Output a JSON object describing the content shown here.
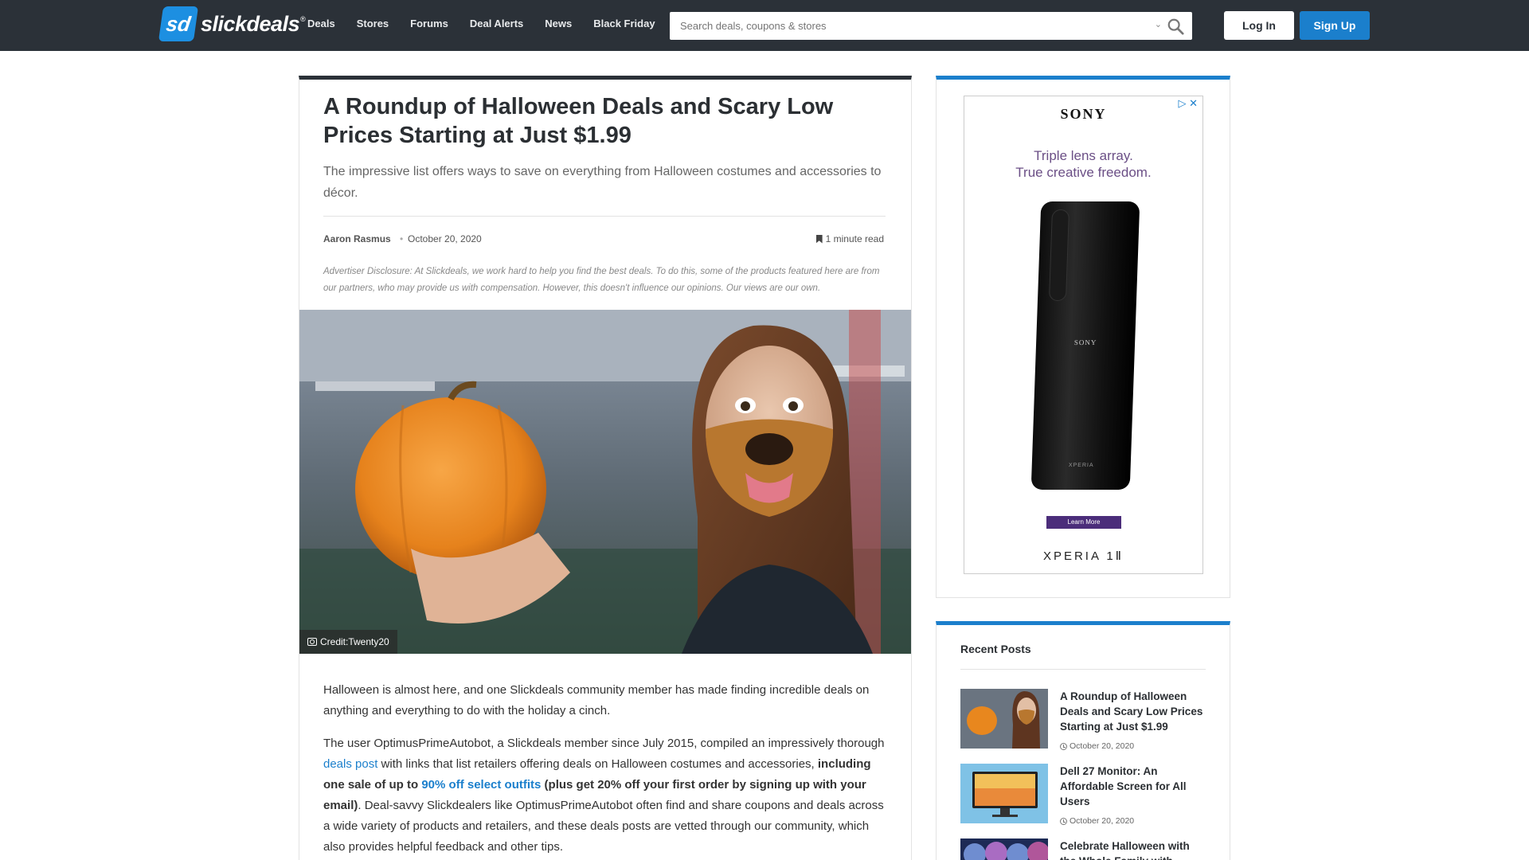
{
  "header": {
    "logo_text": "slickdeals",
    "logo_mark": "sd",
    "logo_reg": "®",
    "nav": [
      "Deals",
      "Stores",
      "Forums",
      "Deal Alerts",
      "News",
      "Black Friday"
    ],
    "search_placeholder": "Search deals, coupons & stores",
    "login_label": "Log In",
    "signup_label": "Sign Up",
    "icons": {
      "search": "search-icon",
      "dropdown": "chevron-down-icon"
    }
  },
  "article": {
    "title": "A Roundup of Halloween Deals and Scary Low Prices Starting at Just $1.99",
    "subtitle": "The impressive list offers ways to save on everything from Halloween costumes and accessories to décor.",
    "author": "Aaron Rasmus",
    "separator": "•",
    "date": "October 20, 2020",
    "read_time": "1 minute read",
    "disclosure": "Advertiser Disclosure: At Slickdeals, we work hard to help you find the best deals. To do this, some of the products featured here are from our partners, who may provide us with compensation. However, this doesn't influence our opinions. Our views are our own.",
    "image_credit": "Credit:Twenty20",
    "p1": "Halloween is almost here, and one Slickdeals community member has made finding incredible deals on anything and everything to do with the holiday a cinch.",
    "p2": {
      "a": "The user OptimusPrimeAutobot, a Slickdeals member since July 2015, compiled an impressively thorough ",
      "link1": "deals post",
      "b": " with links that list retailers offering deals on Halloween costumes and accessories, ",
      "bold1": "including one sale of up to ",
      "link2": "90% off select outfits",
      "bold2": " (plus get 20% off your first order by signing up with your email)",
      "c": ". Deal-savvy Slickdealers like OptimusPrimeAutobot often find and share coupons and deals across a wide variety of products and retailers, and these deals posts are vetted through our community, which also provides helpful feedback and other tips."
    }
  },
  "ad": {
    "brand": "SONY",
    "tagline_1": "Triple lens array.",
    "tagline_2": "True creative freedom.",
    "phone_brand": "SONY",
    "phone_model": "XPERIA",
    "button": "Learn More",
    "product": "XPERIA 1Ⅱ",
    "adchoice": "▷ ✕"
  },
  "recent": {
    "heading": "Recent Posts",
    "posts": [
      {
        "title": "A Roundup of Halloween Deals and Scary Low Prices Starting at Just $1.99",
        "date": "October 20, 2020"
      },
      {
        "title": "Dell 27 Monitor: An Affordable Screen for All Users",
        "date": "October 20, 2020"
      },
      {
        "title": "Celebrate Halloween with the Whole Family with",
        "date": ""
      }
    ]
  },
  "colors": {
    "topbar": "#2b3138",
    "accent": "#1b7fcc",
    "pumpkin": "#e8871e"
  }
}
